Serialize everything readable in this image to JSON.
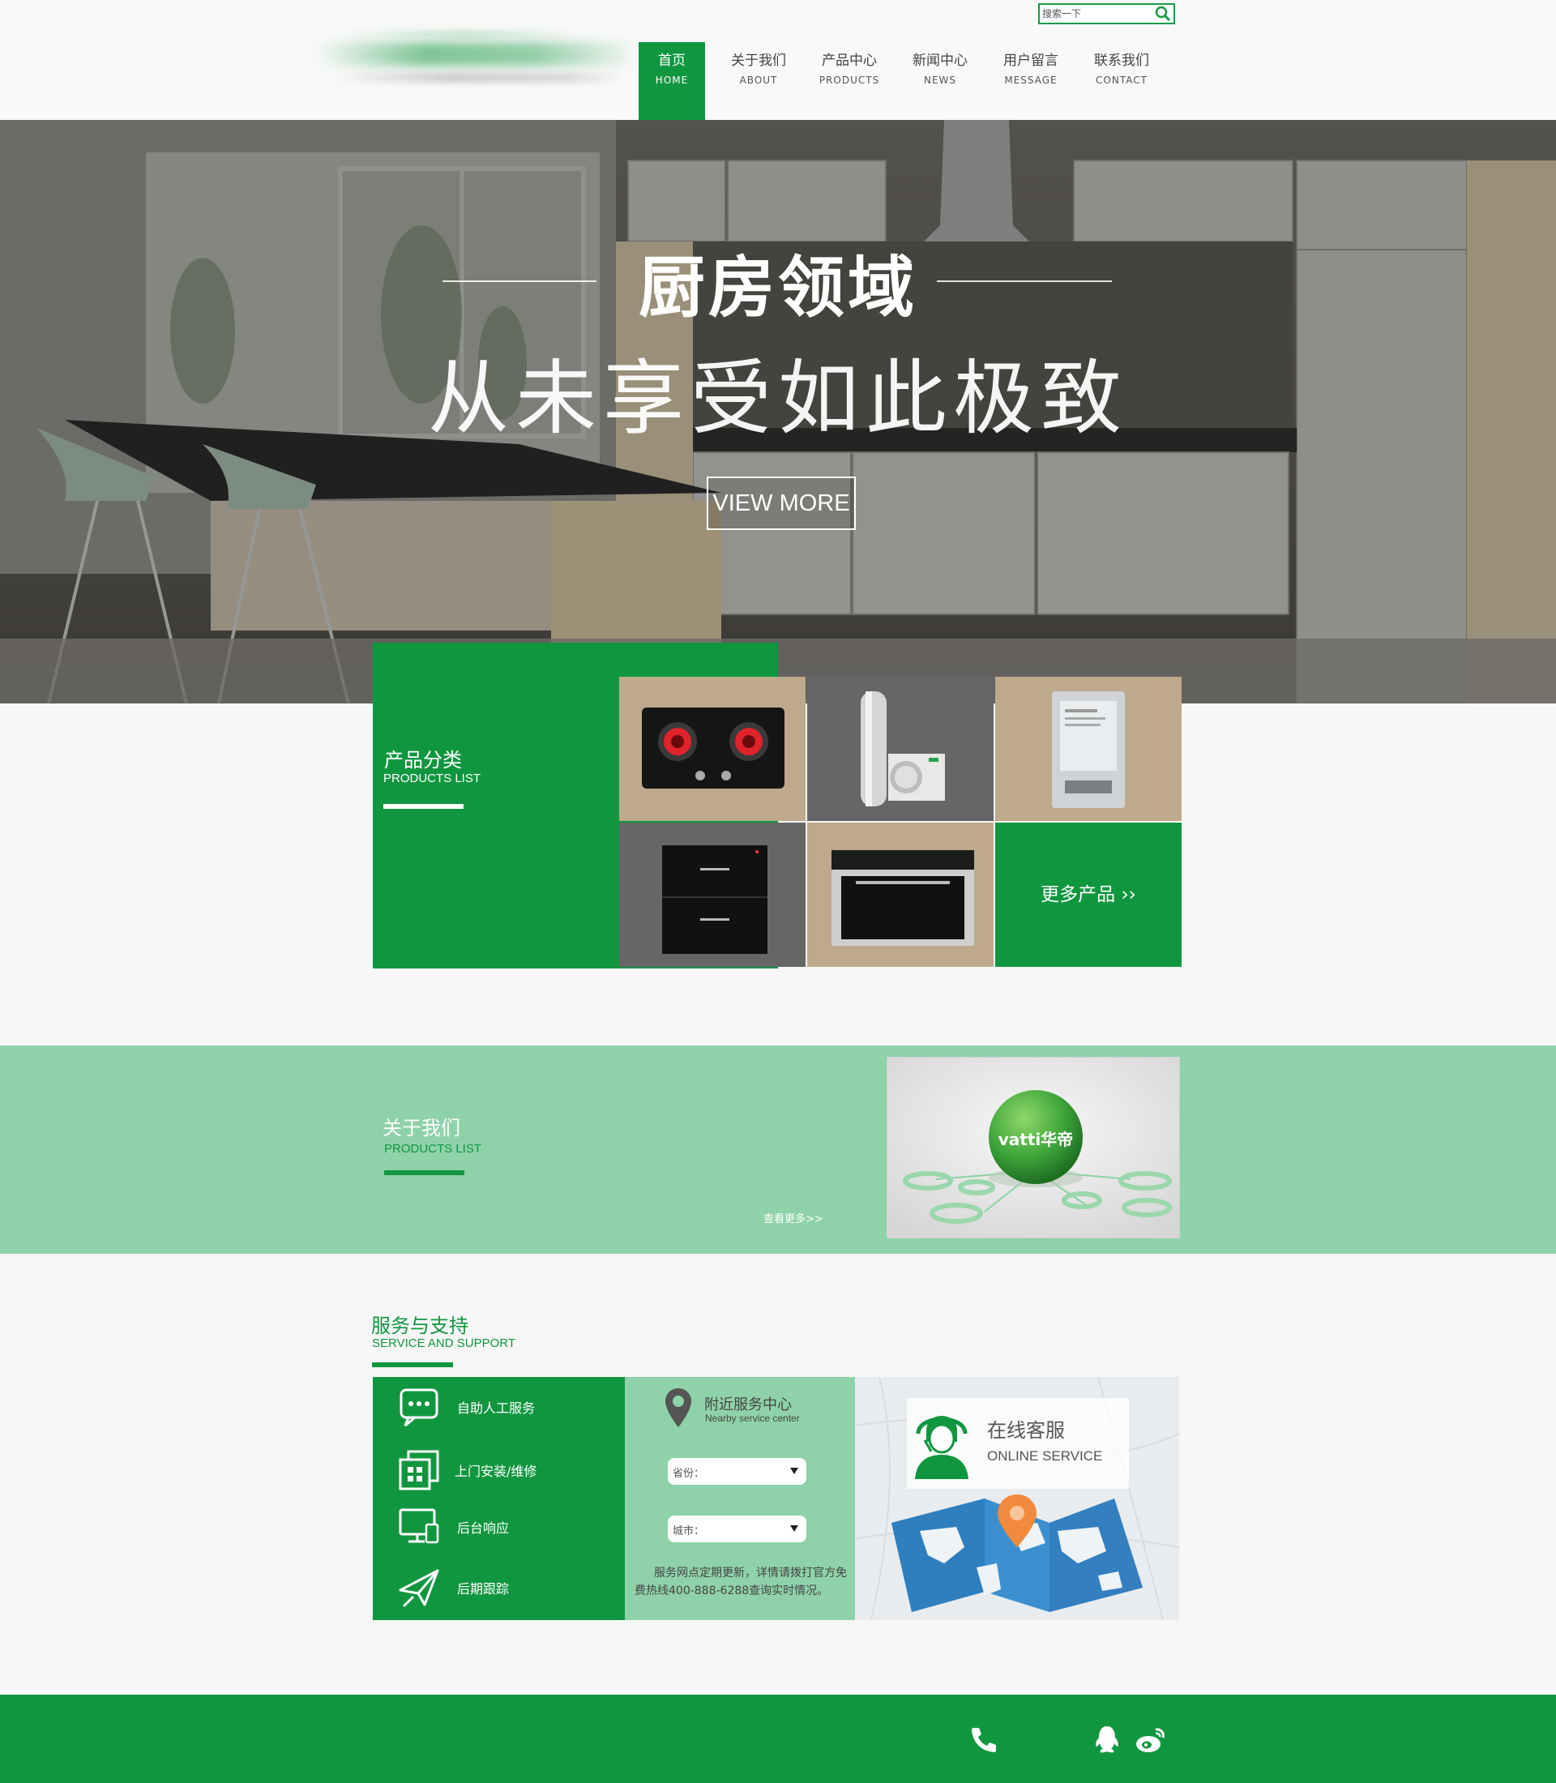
{
  "header": {
    "search": {
      "placeholder": "搜索一下"
    },
    "nav": [
      {
        "cn": "首页",
        "en": "HOME",
        "active": true
      },
      {
        "cn": "关于我们",
        "en": "ABOUT"
      },
      {
        "cn": "产品中心",
        "en": "PRODUCTS"
      },
      {
        "cn": "新闻中心",
        "en": "NEWS"
      },
      {
        "cn": "用户留言",
        "en": "MESSAGE"
      },
      {
        "cn": "联系我们",
        "en": "CONTACT"
      }
    ]
  },
  "hero": {
    "title": "厨房领域",
    "subtitle": "从未享受如此极致",
    "button": "VIEW MORE"
  },
  "products": {
    "title_cn": "产品分类",
    "title_en": "PRODUCTS LIST",
    "more": "更多产品 ››",
    "items": [
      {
        "icon": "gas-stove-icon"
      },
      {
        "icon": "heat-pump-icon"
      },
      {
        "icon": "water-heater-icon"
      },
      {
        "icon": "disinfection-cabinet-icon"
      },
      {
        "icon": "oven-icon"
      }
    ]
  },
  "about": {
    "title_cn": "关于我们",
    "title_en": "PRODUCTS LIST",
    "more": "查看更多>>",
    "logo_text": "vatti华帝"
  },
  "service": {
    "title_cn": "服务与支持",
    "title_en": "SERVICE AND SUPPORT",
    "items": [
      {
        "label": "自助人工服务",
        "icon": "chat-icon"
      },
      {
        "label": "上门安装/维修",
        "icon": "grid-icon"
      },
      {
        "label": "后台响应",
        "icon": "monitor-icon"
      },
      {
        "label": "后期跟踪",
        "icon": "paper-plane-icon"
      }
    ],
    "nearby": {
      "title": "附近服务中心",
      "subtitle": "Nearby service center",
      "province": "省份：",
      "city": "城市：",
      "note": "服务网点定期更新，详情请拨打官方免费热线400-888-6288查询实时情况。"
    },
    "online": {
      "title_cn": "在线客服",
      "title_en": "ONLINE SERVICE"
    }
  },
  "footer": {
    "icons": [
      "phone-icon",
      "qq-icon",
      "weibo-icon"
    ]
  },
  "colors": {
    "brand_green": "#119640",
    "light_green": "#8fd2a9"
  }
}
